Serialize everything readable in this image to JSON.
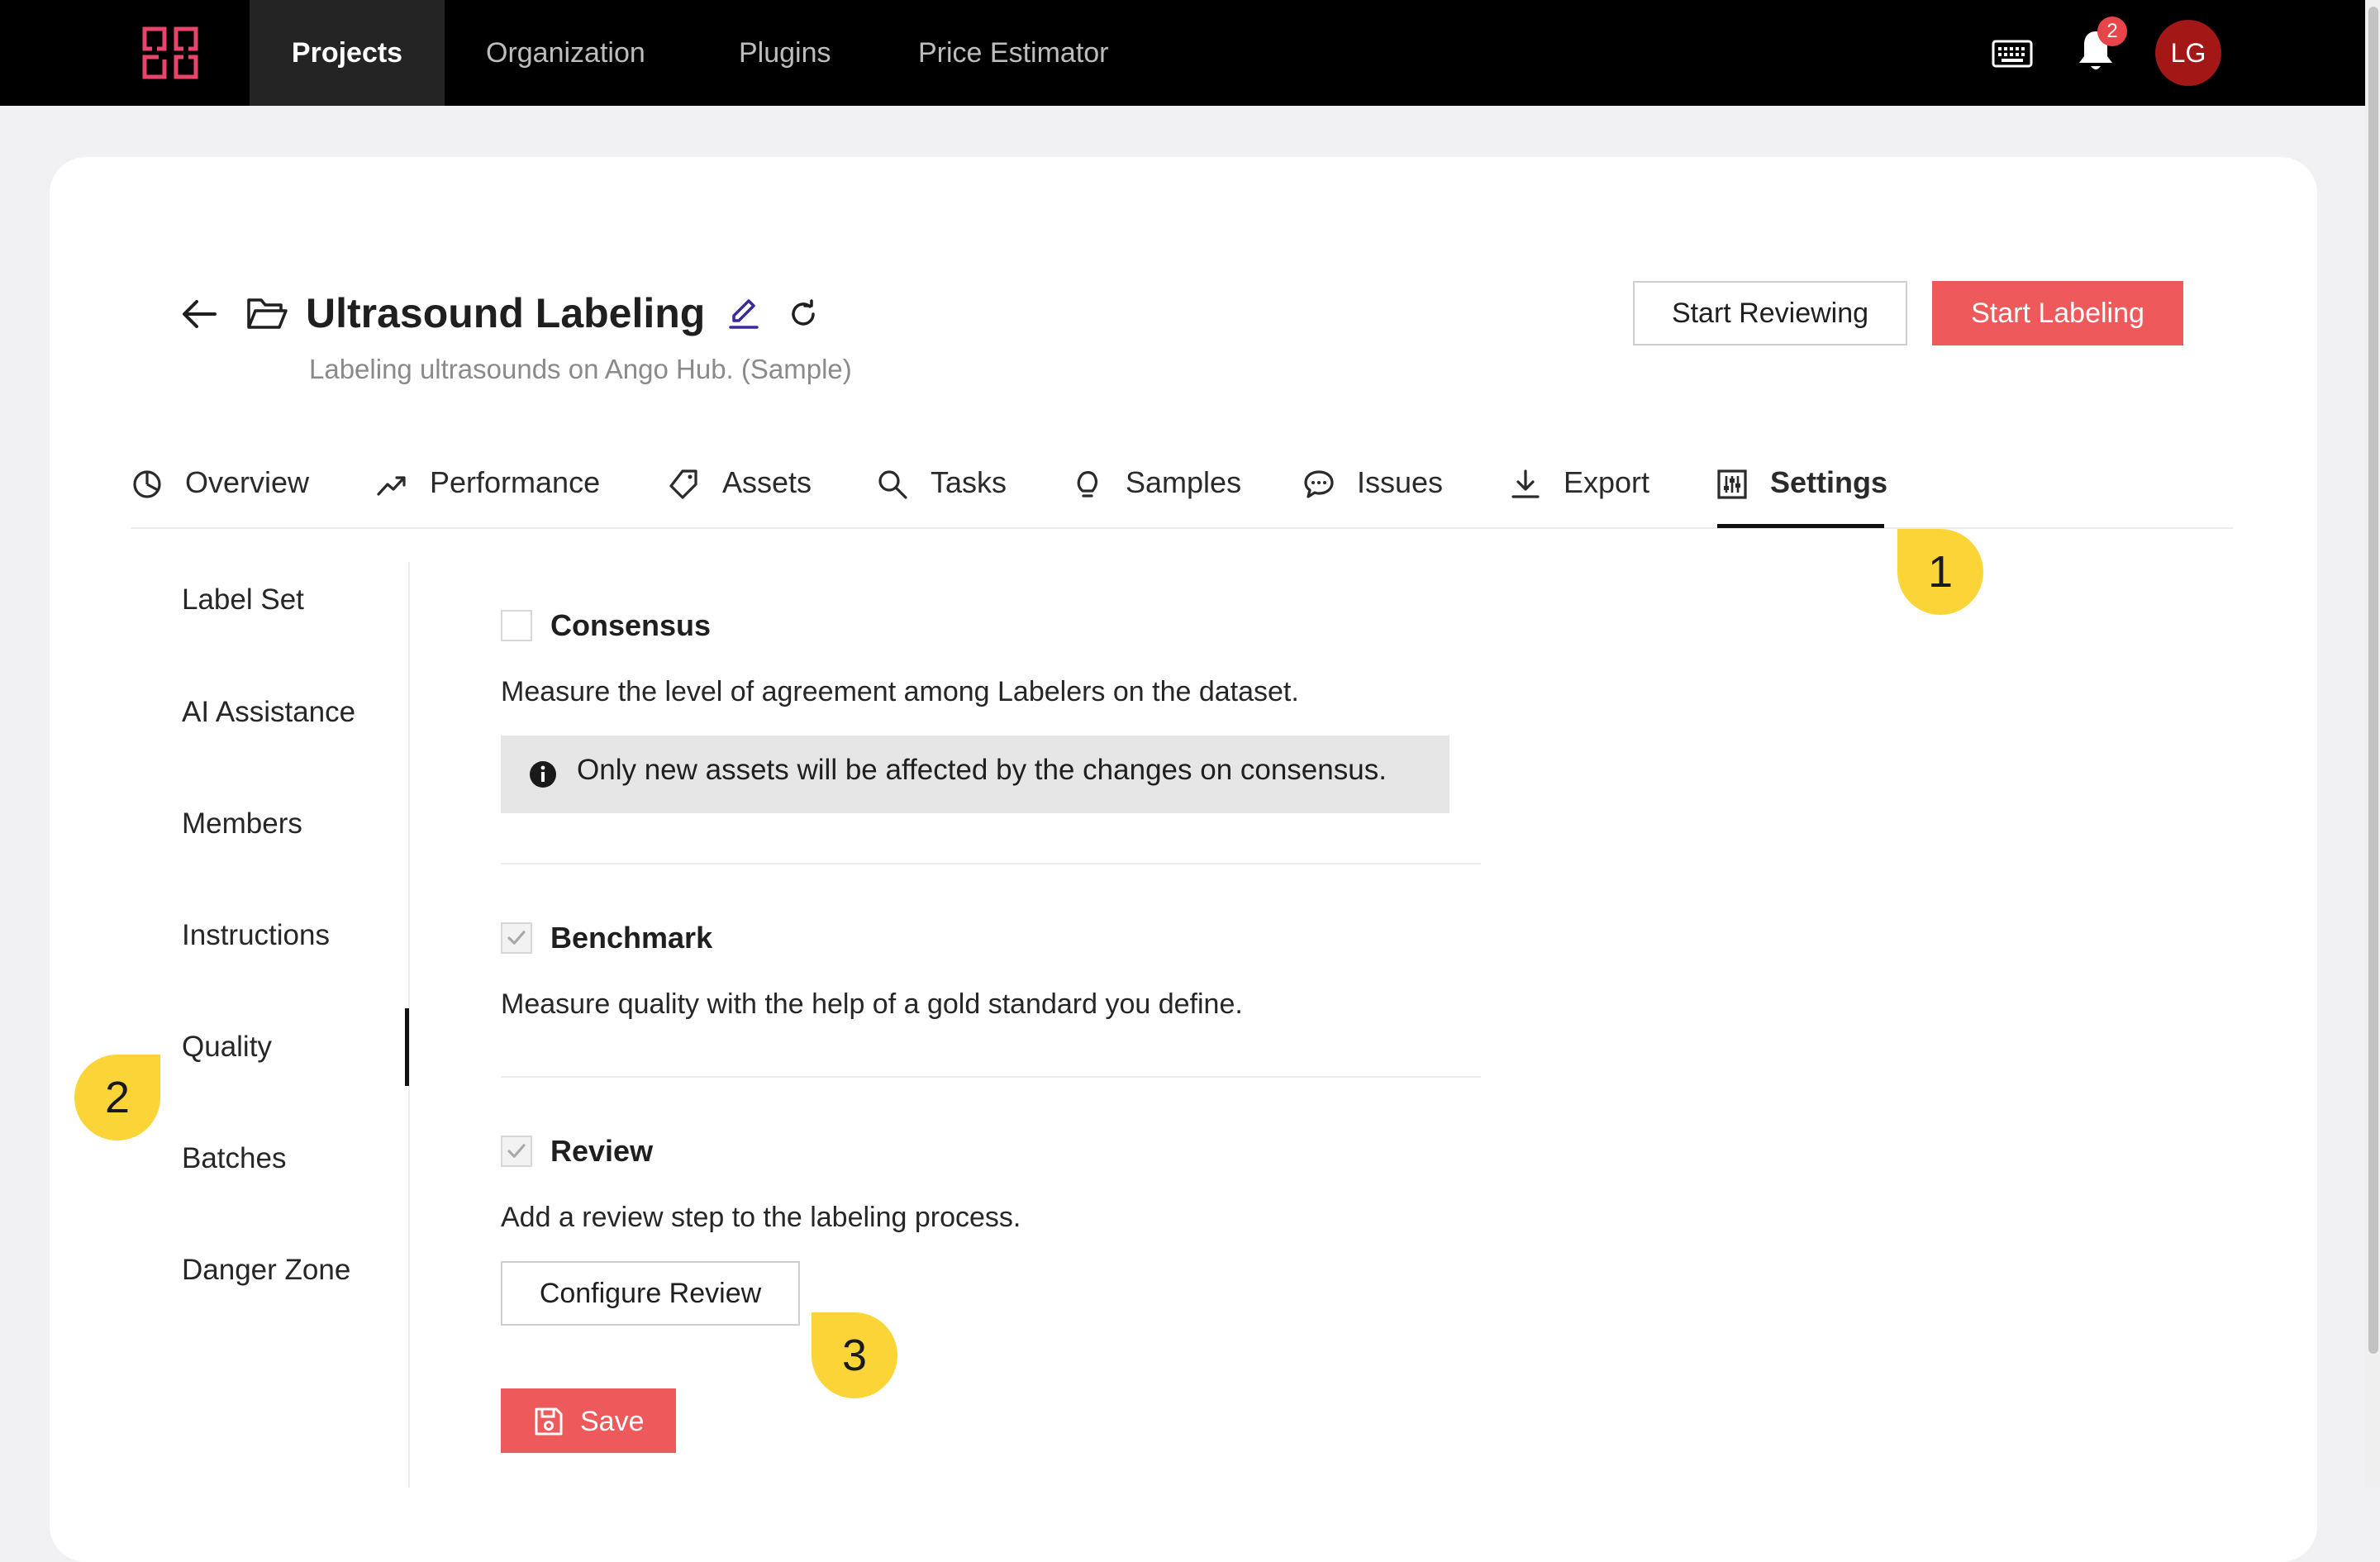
{
  "topnav": {
    "logo": "ango-hub-logo",
    "tabs": [
      "Projects",
      "Organization",
      "Plugins",
      "Price Estimator"
    ],
    "active_tab": "Projects",
    "notification_count": "2",
    "avatar_initials": "LG"
  },
  "project": {
    "title": "Ultrasound Labeling",
    "description": "Labeling ultrasounds on Ango Hub. (Sample)",
    "start_reviewing": "Start Reviewing",
    "start_labeling": "Start Labeling"
  },
  "tabs": [
    {
      "label": "Overview",
      "icon": "pie-chart-icon"
    },
    {
      "label": "Performance",
      "icon": "trend-up-icon"
    },
    {
      "label": "Assets",
      "icon": "tag-icon"
    },
    {
      "label": "Tasks",
      "icon": "search-icon"
    },
    {
      "label": "Samples",
      "icon": "lightbulb-icon"
    },
    {
      "label": "Issues",
      "icon": "chat-icon"
    },
    {
      "label": "Export",
      "icon": "download-icon"
    },
    {
      "label": "Settings",
      "icon": "settings-sliders-icon"
    }
  ],
  "active_tab": "Settings",
  "settings_menu": [
    "Label Set",
    "AI Assistance",
    "Members",
    "Instructions",
    "Quality",
    "Batches",
    "Danger Zone"
  ],
  "active_settings_item": "Quality",
  "quality": {
    "consensus": {
      "title": "Consensus",
      "checked": false,
      "description": "Measure the level of agreement among Labelers on the dataset.",
      "info": "Only new assets will be affected by the changes on consensus."
    },
    "benchmark": {
      "title": "Benchmark",
      "checked": true,
      "description": "Measure quality with the help of a gold standard you define."
    },
    "review": {
      "title": "Review",
      "checked": true,
      "description": "Add a review step to the labeling process.",
      "configure_button": "Configure Review"
    },
    "save_button": "Save"
  },
  "callouts": [
    "1",
    "2",
    "3"
  ],
  "colors": {
    "accent": "#ee5a5c",
    "logo": "#e8456b",
    "callout": "#fbd538",
    "avatar": "#a31717"
  }
}
